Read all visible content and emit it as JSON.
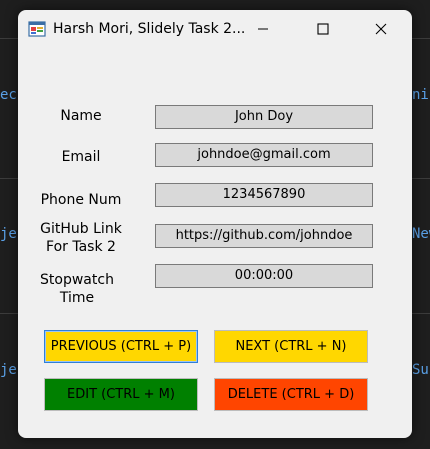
{
  "window": {
    "title": "Harsh Mori, Slidely Task 2..."
  },
  "form": {
    "name_label": "Name",
    "name_value": "John Doy",
    "email_label": "Email",
    "email_value": "johndoe@gmail.com",
    "phone_label": "Phone Num",
    "phone_value": "1234567890",
    "github_label_line1": "GitHub Link",
    "github_label_line2": "For Task 2",
    "github_value": "https://github.com/johndoe",
    "stopwatch_label_line1": "Stopwatch",
    "stopwatch_label_line2": "Time",
    "stopwatch_value": "00:00:00"
  },
  "buttons": {
    "previous": "PREVIOUS (CTRL + P)",
    "next": "NEXT (CTRL + N)",
    "edit": "EDIT (CTRL + M)",
    "delete": "DELETE (CTRL + D)"
  },
  "colors": {
    "previous": "#ffd700",
    "next": "#ffd700",
    "edit": "#008000",
    "delete": "#ff4500"
  },
  "background": {
    "fragments": [
      "ec",
      "nis",
      "je",
      "New",
      "je",
      "Sub"
    ]
  }
}
